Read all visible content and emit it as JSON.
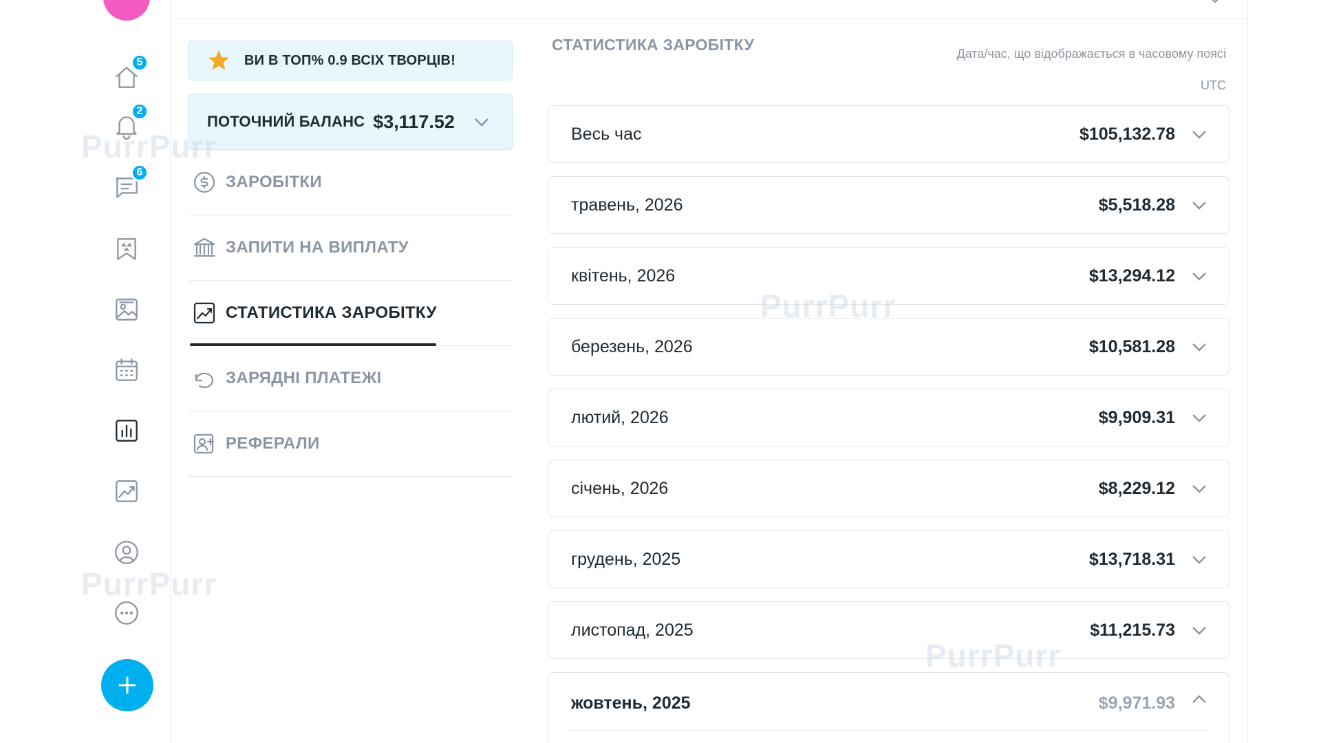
{
  "rail": {
    "items": [
      {
        "name": "home-icon",
        "badge": "5"
      },
      {
        "name": "bell-icon",
        "badge": "2"
      },
      {
        "name": "messages-icon",
        "badge": "6"
      },
      {
        "name": "collections-icon",
        "badge": ""
      },
      {
        "name": "vault-icon",
        "badge": ""
      },
      {
        "name": "calendar-icon",
        "badge": ""
      },
      {
        "name": "statistics-icon",
        "badge": ""
      },
      {
        "name": "trend-icon",
        "badge": ""
      },
      {
        "name": "profile-icon",
        "badge": ""
      },
      {
        "name": "more-icon",
        "badge": ""
      }
    ],
    "accent": "#00aff0",
    "avatar_color": "#f25ac4"
  },
  "banner": {
    "text": "ВИ В ТОП% 0.9 ВСІХ ТВОРЦІВ!",
    "icon": "star-icon"
  },
  "balance": {
    "label": "ПОТОЧНИЙ БАЛАНС",
    "amount": "$3,117.52"
  },
  "menu": [
    {
      "label": "ЗАРОБІТКИ",
      "icon": "dollar-circle-icon",
      "active": false
    },
    {
      "label": "ЗАПИТИ НА ВИПЛАТУ",
      "icon": "bank-icon",
      "active": false
    },
    {
      "label": "СТАТИСТИКА ЗАРОБІТКУ",
      "icon": "chart-icon",
      "active": true
    },
    {
      "label": "ЗАРЯДНІ ПЛАТЕЖІ",
      "icon": "undo-icon",
      "active": false
    },
    {
      "label": "РЕФЕРАЛИ",
      "icon": "referral-icon",
      "active": false
    }
  ],
  "stats": {
    "title": "СТАТИСТИКА ЗАРОБІТКУ",
    "tz_note_line1": "Дата/час, що відображається в часовому поясі",
    "tz_note_line2": "UTC",
    "rows": [
      {
        "period": "Весь час",
        "value": "$105,132.78",
        "expanded": false
      },
      {
        "period": "травень, 2026",
        "value": "$5,518.28",
        "expanded": false
      },
      {
        "period": "квітень, 2026",
        "value": "$13,294.12",
        "expanded": false
      },
      {
        "period": "березень, 2026",
        "value": "$10,581.28",
        "expanded": false
      },
      {
        "period": "лютий, 2026",
        "value": "$9,909.31",
        "expanded": false
      },
      {
        "period": "січень, 2026",
        "value": "$8,229.12",
        "expanded": false
      },
      {
        "period": "грудень, 2025",
        "value": "$13,718.31",
        "expanded": false
      },
      {
        "period": "листопад, 2025",
        "value": "$11,215.73",
        "expanded": false
      },
      {
        "period": "жовтень, 2025",
        "value": "$9,971.93",
        "expanded": true
      }
    ]
  },
  "watermark": "PurrPurr"
}
